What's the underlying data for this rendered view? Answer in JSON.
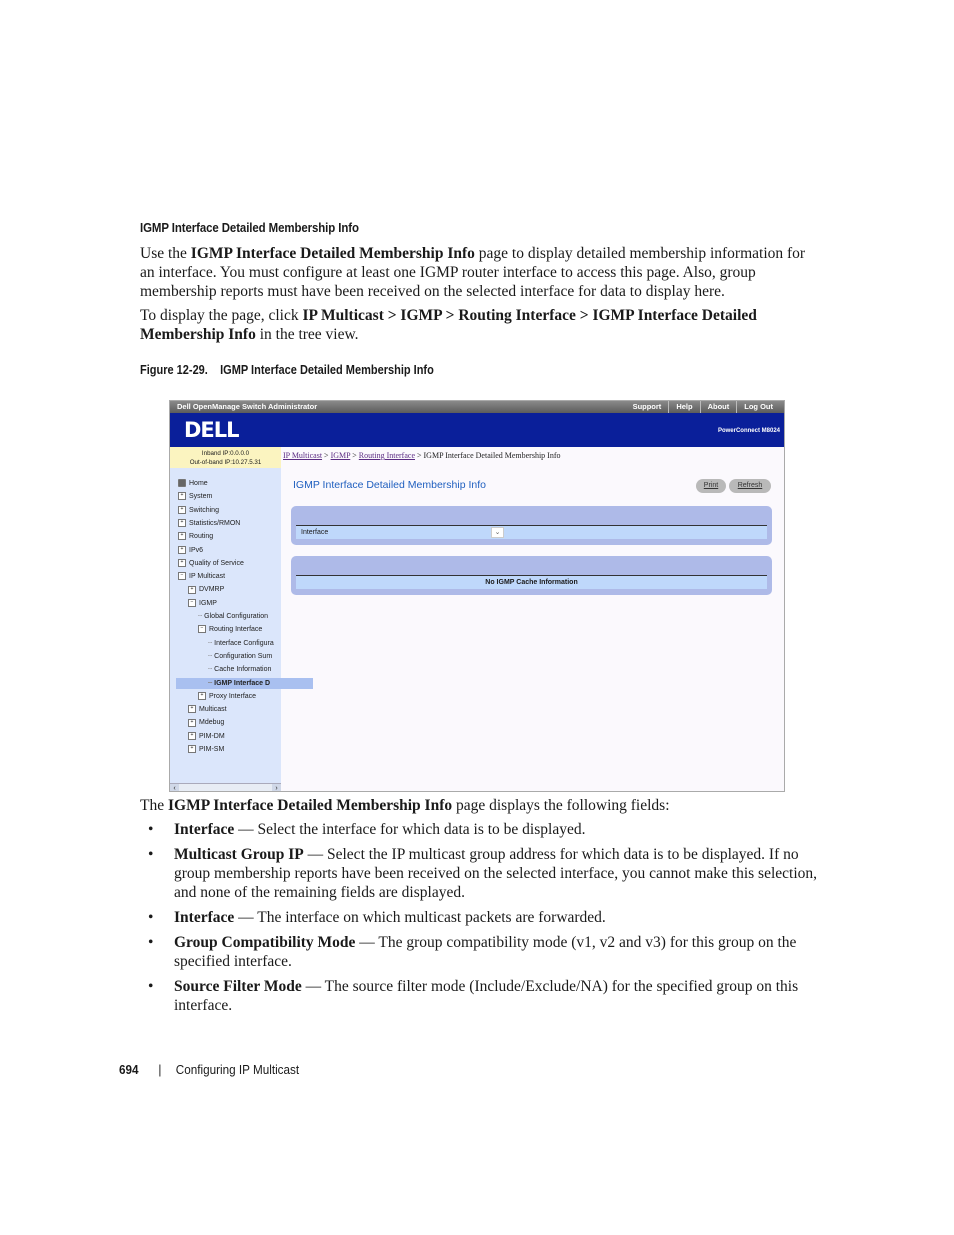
{
  "section_title": "IGMP Interface Detailed Membership Info",
  "intro": {
    "p1_pre": "Use the ",
    "p1_bold": "IGMP Interface Detailed Membership Info",
    "p1_post": " page to display detailed membership information for an interface. You must configure at least one IGMP router interface to access this page. Also, group membership reports must have been received on the selected interface for data to display here.",
    "p2_pre": "To display the page, click ",
    "p2_bold": "IP Multicast > IGMP > Routing Interface > IGMP Interface Detailed Membership Info",
    "p2_post": " in the tree view."
  },
  "figure_caption": "Figure 12-29.    IGMP Interface Detailed Membership Info",
  "screenshot": {
    "app_title": "Dell OpenManage Switch Administrator",
    "top_links": [
      "Support",
      "Help",
      "About",
      "Log Out"
    ],
    "logo": "DELL",
    "product": "PowerConnect M8024",
    "inband_ip": "Inband IP:0.0.0.0",
    "oob_ip": "Out-of-band IP:10.27.5.31",
    "breadcrumb": {
      "links": [
        "IP Multicast",
        "IGMP",
        "Routing Interface"
      ],
      "separator": ">",
      "current": "IGMP Interface Detailed Membership Info"
    },
    "tree": [
      {
        "label": "Home",
        "icon": "home-icon",
        "level": 0
      },
      {
        "label": "System",
        "icon": "expand-icon",
        "level": 0
      },
      {
        "label": "Switching",
        "icon": "expand-icon",
        "level": 0
      },
      {
        "label": "Statistics/RMON",
        "icon": "expand-icon",
        "level": 0
      },
      {
        "label": "Routing",
        "icon": "expand-icon",
        "level": 0
      },
      {
        "label": "IPv6",
        "icon": "expand-icon",
        "level": 0
      },
      {
        "label": "Quality of Service",
        "icon": "expand-icon",
        "level": 0
      },
      {
        "label": "IP Multicast",
        "icon": "collapse-icon",
        "level": 0
      },
      {
        "label": "DVMRP",
        "icon": "expand-icon",
        "level": 1
      },
      {
        "label": "IGMP",
        "icon": "collapse-icon",
        "level": 1
      },
      {
        "label": "Global Configuration",
        "icon": "leaf",
        "level": 2
      },
      {
        "label": "Routing Interface",
        "icon": "collapse-icon",
        "level": 2
      },
      {
        "label": "Interface Configura",
        "icon": "leaf",
        "level": 3
      },
      {
        "label": "Configuration Sum",
        "icon": "leaf",
        "level": 3
      },
      {
        "label": "Cache Information",
        "icon": "leaf",
        "level": 3
      },
      {
        "label": "IGMP Interface D",
        "icon": "leaf",
        "level": 3,
        "selected": true
      },
      {
        "label": "Proxy Interface",
        "icon": "expand-icon",
        "level": 2
      },
      {
        "label": "Multicast",
        "icon": "expand-icon",
        "level": 1
      },
      {
        "label": "Mdebug",
        "icon": "expand-icon",
        "level": 1
      },
      {
        "label": "PIM-DM",
        "icon": "expand-icon",
        "level": 1
      },
      {
        "label": "PIM-SM",
        "icon": "expand-icon",
        "level": 1
      }
    ],
    "page_title": "IGMP Interface Detailed Membership Info",
    "print_label": "Print",
    "refresh_label": "Refresh",
    "interface_label": "Interface",
    "interface_value": "",
    "empty_message": "No IGMP Cache Information",
    "colors": {
      "banner": "#0a1f9a",
      "title": "#1f5fbf",
      "panel": "#aebae8",
      "row": "#bfd8fb",
      "tree_bg": "#dbe6fb",
      "selected": "#a9c0f0"
    }
  },
  "fields_intro": {
    "pre": "The ",
    "bold": "IGMP Interface Detailed Membership Info",
    "post": " page displays the following fields:"
  },
  "fields": [
    {
      "name": "Interface",
      "desc": " — Select the interface for which data is to be displayed."
    },
    {
      "name": "Multicast Group IP",
      "desc": " — Select the IP multicast group address for which data is to be displayed. If no group membership reports have been received on the selected interface, you cannot make this selection, and none of the remaining fields are displayed."
    },
    {
      "name": "Interface",
      "desc": " — The interface on which multicast packets are forwarded."
    },
    {
      "name": "Group Compatibility Mode",
      "desc": " — The group compatibility mode (v1, v2 and v3) for this group on the specified interface."
    },
    {
      "name": "Source Filter Mode",
      "desc": " — The source filter mode (Include/Exclude/NA) for the specified group on this interface."
    }
  ],
  "footer": {
    "page_number": "694",
    "separator": "|",
    "chapter": "Configuring IP Multicast"
  }
}
